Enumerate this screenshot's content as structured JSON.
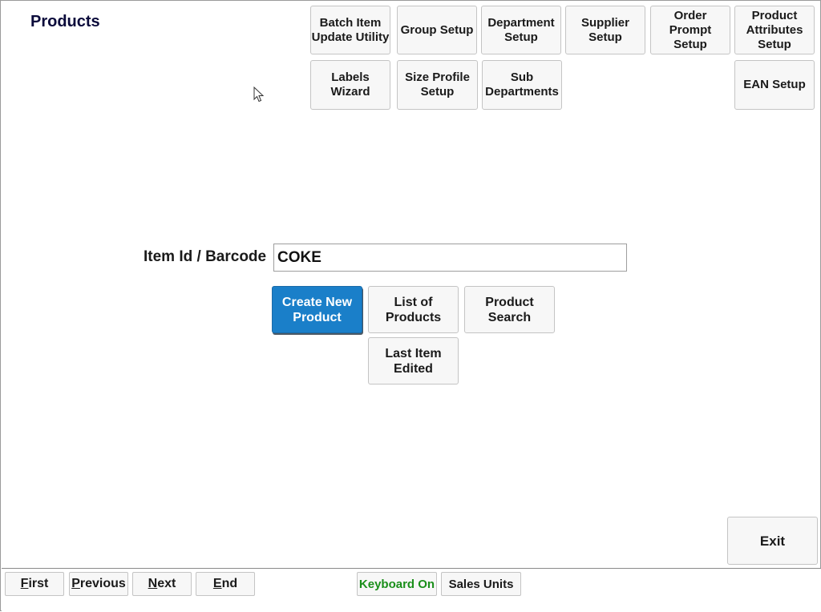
{
  "page": {
    "title": "Products"
  },
  "top_buttons": {
    "batch_item": "Batch Item\nUpdate Utility",
    "group_setup": "Group Setup",
    "department_setup": "Department\nSetup",
    "supplier_setup": "Supplier\nSetup",
    "order_prompt_setup": "Order\nPrompt\nSetup",
    "product_attributes_setup": "Product\nAttributes\nSetup",
    "labels_wizard": "Labels\nWizard",
    "size_profile_setup": "Size Profile\nSetup",
    "sub_departments": "Sub\nDepartments",
    "ean_setup": "EAN Setup"
  },
  "search": {
    "label": "Item Id / Barcode",
    "value": "COKE"
  },
  "actions": {
    "create_new_product": "Create New\nProduct",
    "list_of_products": "List of\nProducts",
    "product_search": "Product\nSearch",
    "last_item_edited": "Last Item\nEdited",
    "exit": "Exit"
  },
  "bottom_bar": {
    "first_key": "F",
    "first_rest": "irst",
    "previous_key": "P",
    "previous_rest": "revious",
    "next_key": "N",
    "next_rest": "ext",
    "end_key": "E",
    "end_rest": "nd",
    "keyboard": "Keyboard On",
    "sales_units": "Sales Units"
  },
  "colors": {
    "primary_button": "#1a7fc9",
    "keyboard_on_text": "#1a8f1a",
    "title": "#0b0b3b"
  }
}
